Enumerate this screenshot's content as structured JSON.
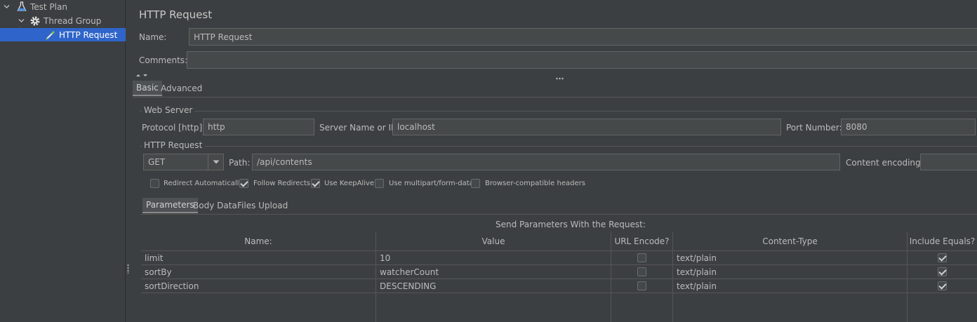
{
  "tree": {
    "items": [
      {
        "label": "Test Plan",
        "icon": "flask-icon"
      },
      {
        "label": "Thread Group",
        "icon": "gear-icon"
      },
      {
        "label": "HTTP Request",
        "icon": "pipette-icon"
      }
    ]
  },
  "main": {
    "title": "HTTP Request",
    "name_label": "Name:",
    "name_value": "HTTP Request",
    "comments_label": "Comments:",
    "comments_value": "",
    "tabs": [
      {
        "label": "Basic"
      },
      {
        "label": "Advanced"
      }
    ],
    "web_server": {
      "group_title": "Web Server",
      "protocol_label": "Protocol [http]:",
      "protocol_value": "http",
      "server_label": "Server Name or IP:",
      "server_value": "localhost",
      "port_label": "Port Number:",
      "port_value": "8080"
    },
    "http_request": {
      "group_title": "HTTP Request",
      "method": "GET",
      "path_label": "Path:",
      "path_value": "/api/contents",
      "encoding_label": "Content encoding:",
      "encoding_value": "",
      "options": [
        {
          "label": "Redirect Automatically",
          "checked": false
        },
        {
          "label": "Follow Redirects",
          "checked": true
        },
        {
          "label": "Use KeepAlive",
          "checked": true
        },
        {
          "label": "Use multipart/form-data",
          "checked": false
        },
        {
          "label": "Browser-compatible headers",
          "checked": false
        }
      ]
    },
    "sub_tabs": [
      {
        "label": "Parameters"
      },
      {
        "label": "Body Data"
      },
      {
        "label": "Files Upload"
      }
    ],
    "params": {
      "caption": "Send Parameters With the Request:",
      "columns": [
        "Name:",
        "Value",
        "URL Encode?",
        "Content-Type",
        "Include Equals?"
      ],
      "rows": [
        {
          "name": "limit",
          "value": "10",
          "url_encode": false,
          "content_type": "text/plain",
          "include_equals": true
        },
        {
          "name": "sortBy",
          "value": "watcherCount",
          "url_encode": false,
          "content_type": "text/plain",
          "include_equals": true
        },
        {
          "name": "sortDirection",
          "value": "DESCENDING",
          "url_encode": false,
          "content_type": "text/plain",
          "include_equals": true
        }
      ]
    }
  },
  "colors": {
    "background": "#3c3f41",
    "selection": "#2f65ca",
    "field": "#45494a",
    "text": "#bbbbbb"
  }
}
